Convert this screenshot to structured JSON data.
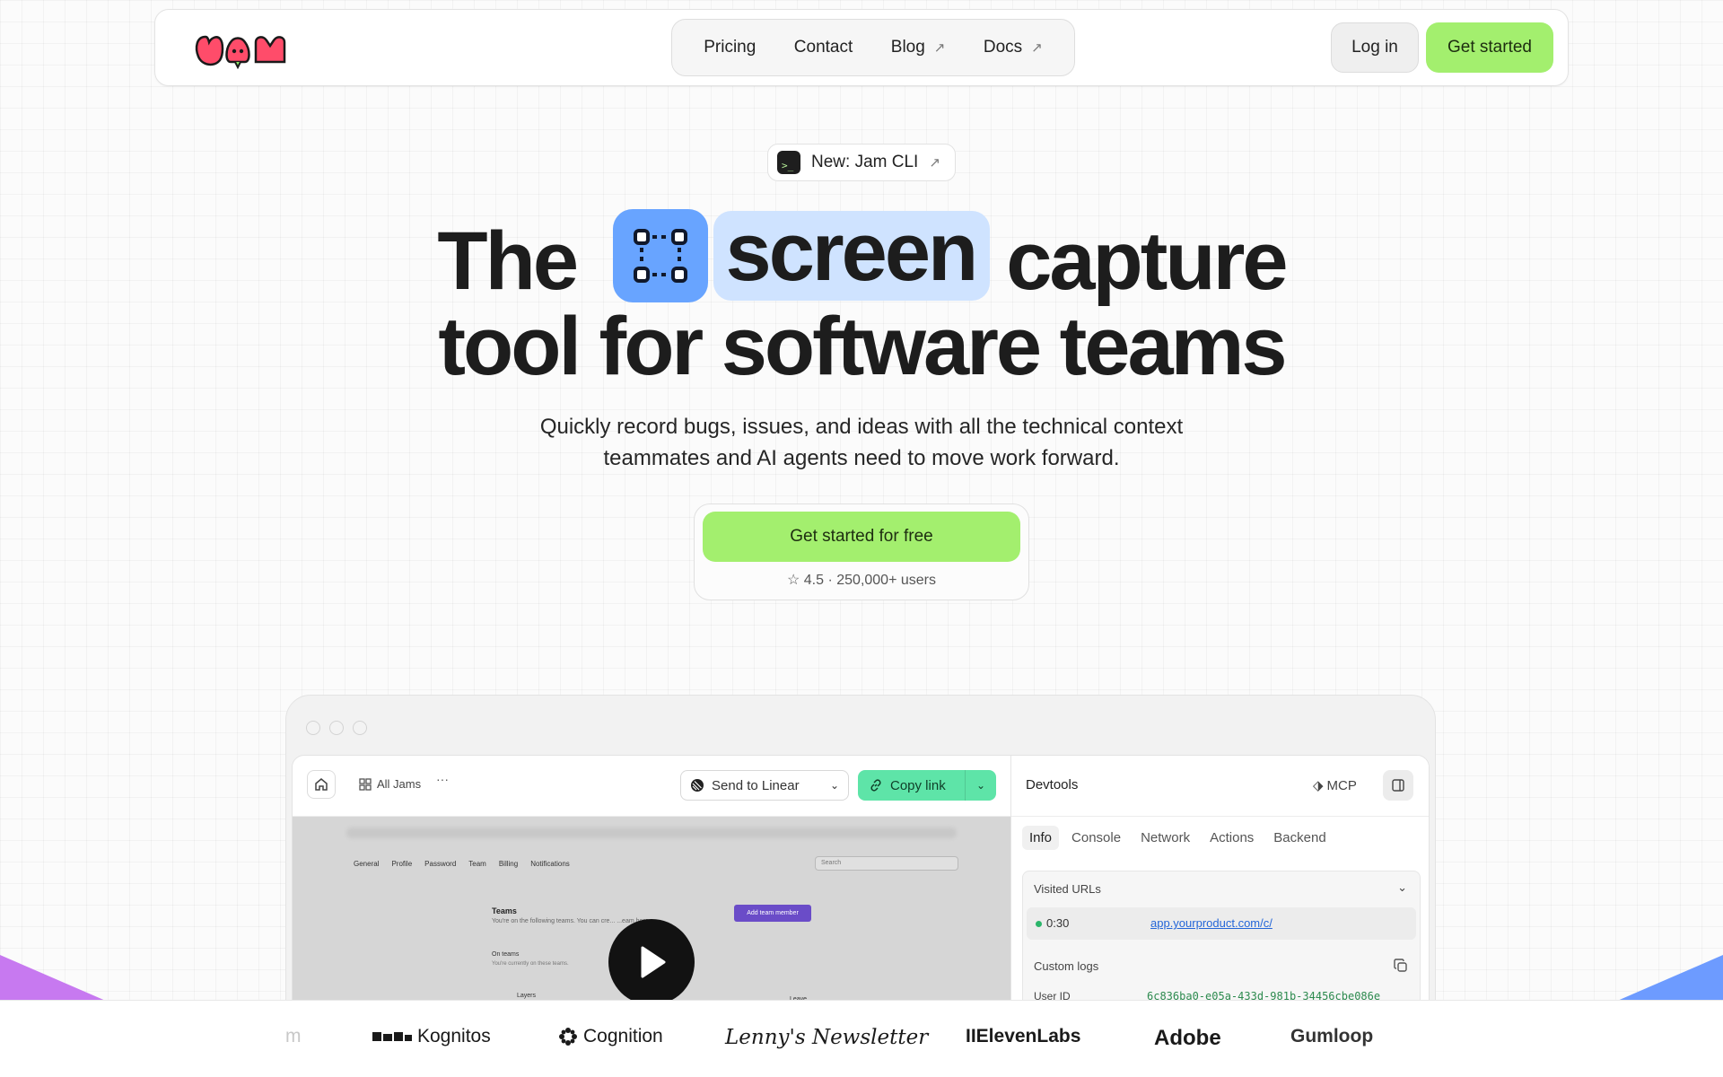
{
  "nav": {
    "links": [
      {
        "label": "Pricing",
        "external": false
      },
      {
        "label": "Contact",
        "external": false
      },
      {
        "label": "Blog",
        "external": true
      },
      {
        "label": "Docs",
        "external": true
      }
    ],
    "login_label": "Log in",
    "get_started_label": "Get started"
  },
  "announcement": {
    "label": "New: Jam CLI",
    "icon": "terminal-icon"
  },
  "hero": {
    "title_word_1": "The",
    "title_word_2": "screen",
    "title_word_3": "capture",
    "title_line_2": "tool for software teams",
    "subtitle": "Quickly record bugs, issues, and ideas with all the technical context teammates and AI agents need to move work forward.",
    "cta_label": "Get started for free",
    "rating_text": "4.5 · 250,000+ users"
  },
  "colors": {
    "accent_green": "#a3ef6e",
    "highlight_blue": "#cfe3ff",
    "icon_blue": "#68a4ff",
    "copy_link_green": "#5ee4a8",
    "logo_red": "#ff4c6a"
  },
  "app": {
    "toolbar": {
      "all_jams_label": "All Jams",
      "more_label": "···",
      "send_to_label": "Send to Linear",
      "copy_link_label": "Copy link"
    },
    "video": {
      "tabs": [
        "General",
        "Profile",
        "Password",
        "Team",
        "Billing",
        "Notifications"
      ],
      "search_placeholder": "Search",
      "teams_title": "Teams",
      "teams_subtitle": "You're on the following teams. You can cre... ...eam here.",
      "add_button": "Add team member",
      "on_teams_title": "On teams",
      "on_teams_subtitle": "You're currently on these teams.",
      "layers_label": "Layers",
      "leave_label": "Leave"
    },
    "devtools": {
      "title": "Devtools",
      "mcp_label": "MCP",
      "tabs": [
        "Info",
        "Console",
        "Network",
        "Actions",
        "Backend"
      ],
      "active_tab": "Info",
      "visited_urls_label": "Visited URLs",
      "visited_time": "0:30",
      "visited_url": "app.yourproduct.com/c/",
      "custom_logs_label": "Custom logs",
      "user_id_label": "User ID",
      "user_id_value": "6c836ba0-e05a-433d-981b-34456cbe086e"
    }
  },
  "logos": {
    "partial": "m",
    "kognitos": "Kognitos",
    "cognition": "Cognition",
    "lenny": "Lenny's Newsletter",
    "elevenlabs": "IIElevenLabs",
    "adobe": "Adobe",
    "gumloop": "Gumloop"
  }
}
